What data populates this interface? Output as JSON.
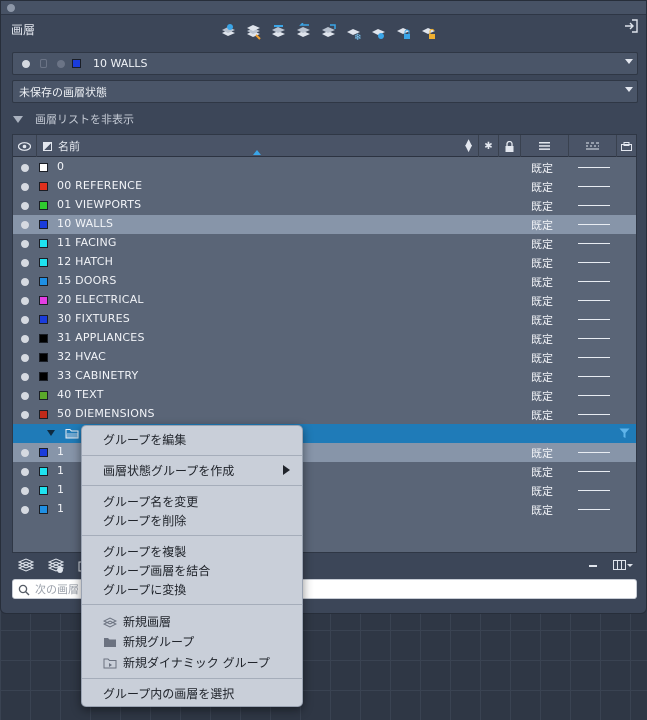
{
  "palette": {
    "title": "画層"
  },
  "toolbar": {
    "tools": [
      "layer-properties-icon",
      "layer-state-icon",
      "layer-match-icon",
      "layer-previous-icon",
      "layer-isolate-icon",
      "layer-freeze-icon",
      "layer-off-icon",
      "layer-lock-icon",
      "layer-unlock-icon"
    ]
  },
  "current_layer": {
    "name": "10 WALLS",
    "color": "#1a3cdb"
  },
  "layer_state": {
    "value": "未保存の画層状態"
  },
  "list_toggle": {
    "label": "画層リストを非表示"
  },
  "header": {
    "name_label": "名前"
  },
  "rows": [
    {
      "name": "0",
      "color": "#ffffff",
      "lineweight": "既定"
    },
    {
      "name": "00 REFERENCE",
      "color": "#e0301e",
      "lineweight": "既定"
    },
    {
      "name": "01 VIEWPORTS",
      "color": "#2fcc2f",
      "lineweight": "既定"
    },
    {
      "name": "10 WALLS",
      "color": "#1a3cdb",
      "lineweight": "既定",
      "selected": true
    },
    {
      "name": "11 FACING",
      "color": "#1ee3f0",
      "lineweight": "既定"
    },
    {
      "name": "12 HATCH",
      "color": "#1ee3f0",
      "lineweight": "既定"
    },
    {
      "name": "15 DOORS",
      "color": "#1f8fe3",
      "lineweight": "既定"
    },
    {
      "name": "20 ELECTRICAL",
      "color": "#e43ee4",
      "lineweight": "既定"
    },
    {
      "name": "30 FIXTURES",
      "color": "#1a3cdb",
      "lineweight": "既定"
    },
    {
      "name": "31 APPLIANCES",
      "color": "#000000",
      "lineweight": "既定"
    },
    {
      "name": "32 HVAC",
      "color": "#000000",
      "lineweight": "既定"
    },
    {
      "name": "33 CABINETRY",
      "color": "#000000",
      "lineweight": "既定"
    },
    {
      "name": "40 TEXT",
      "color": "#5aa82a",
      "lineweight": "既定"
    },
    {
      "name": "50 DIEMENSIONS",
      "color": "#c02a1a",
      "lineweight": "既定"
    }
  ],
  "group_rows": [
    {
      "name": "1",
      "color": "#1a3cdb",
      "lineweight": "既定",
      "selected": true
    },
    {
      "name": "1",
      "color": "#1ee3f0",
      "lineweight": "既定"
    },
    {
      "name": "1",
      "color": "#1ee3f0",
      "lineweight": "既定"
    },
    {
      "name": "1",
      "color": "#1f8fe3",
      "lineweight": "既定"
    }
  ],
  "search": {
    "placeholder": "次の画層"
  },
  "context_menu": {
    "edit_group": "グループを編集",
    "create_state_group": "画層状態グループを作成",
    "rename_group": "グループ名を変更",
    "delete_group": "グループを削除",
    "duplicate_group": "グループを複製",
    "merge_group_layers": "グループ画層を結合",
    "convert_to_group": "グループに変換",
    "new_layer": "新規画層",
    "new_group": "新規グループ",
    "new_dynamic_group": "新規ダイナミック グループ",
    "select_layers_in_group": "グループ内の画層を選択"
  },
  "colors": {
    "selection": "#8795a9",
    "group_highlight": "#1f7bb8",
    "panel": "#3c4658"
  }
}
